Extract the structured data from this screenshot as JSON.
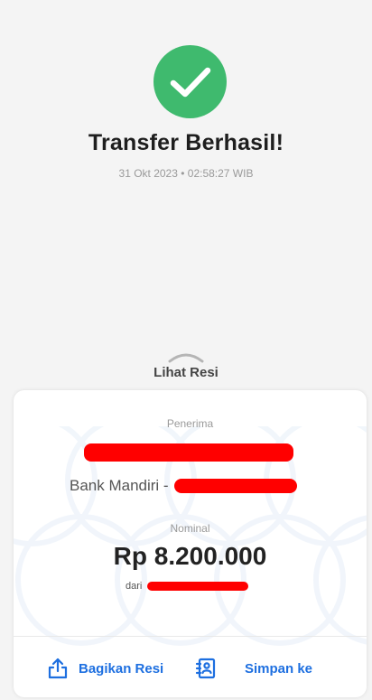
{
  "status": {
    "title": "Transfer Berhasil!",
    "timestamp": "31 Okt 2023 • 02:58:27 WIB",
    "icon": "check-icon",
    "color": "#3fba6e"
  },
  "receipt_toggle": {
    "label": "Lihat Resi",
    "icon": "chevron-up-icon"
  },
  "receipt": {
    "recipient_label": "Penerima",
    "bank_prefix": "Bank Mandiri -",
    "amount_label": "Nominal",
    "amount": "Rp 8.200.000",
    "from_prefix": "dari",
    "redaction_color": "#ff0000"
  },
  "actions": {
    "share_label": "Bagikan Resi",
    "share_icon": "share-icon",
    "save_label": "Simpan ke",
    "save_icon": "contact-book-icon",
    "accent": "#1d6fe0"
  }
}
